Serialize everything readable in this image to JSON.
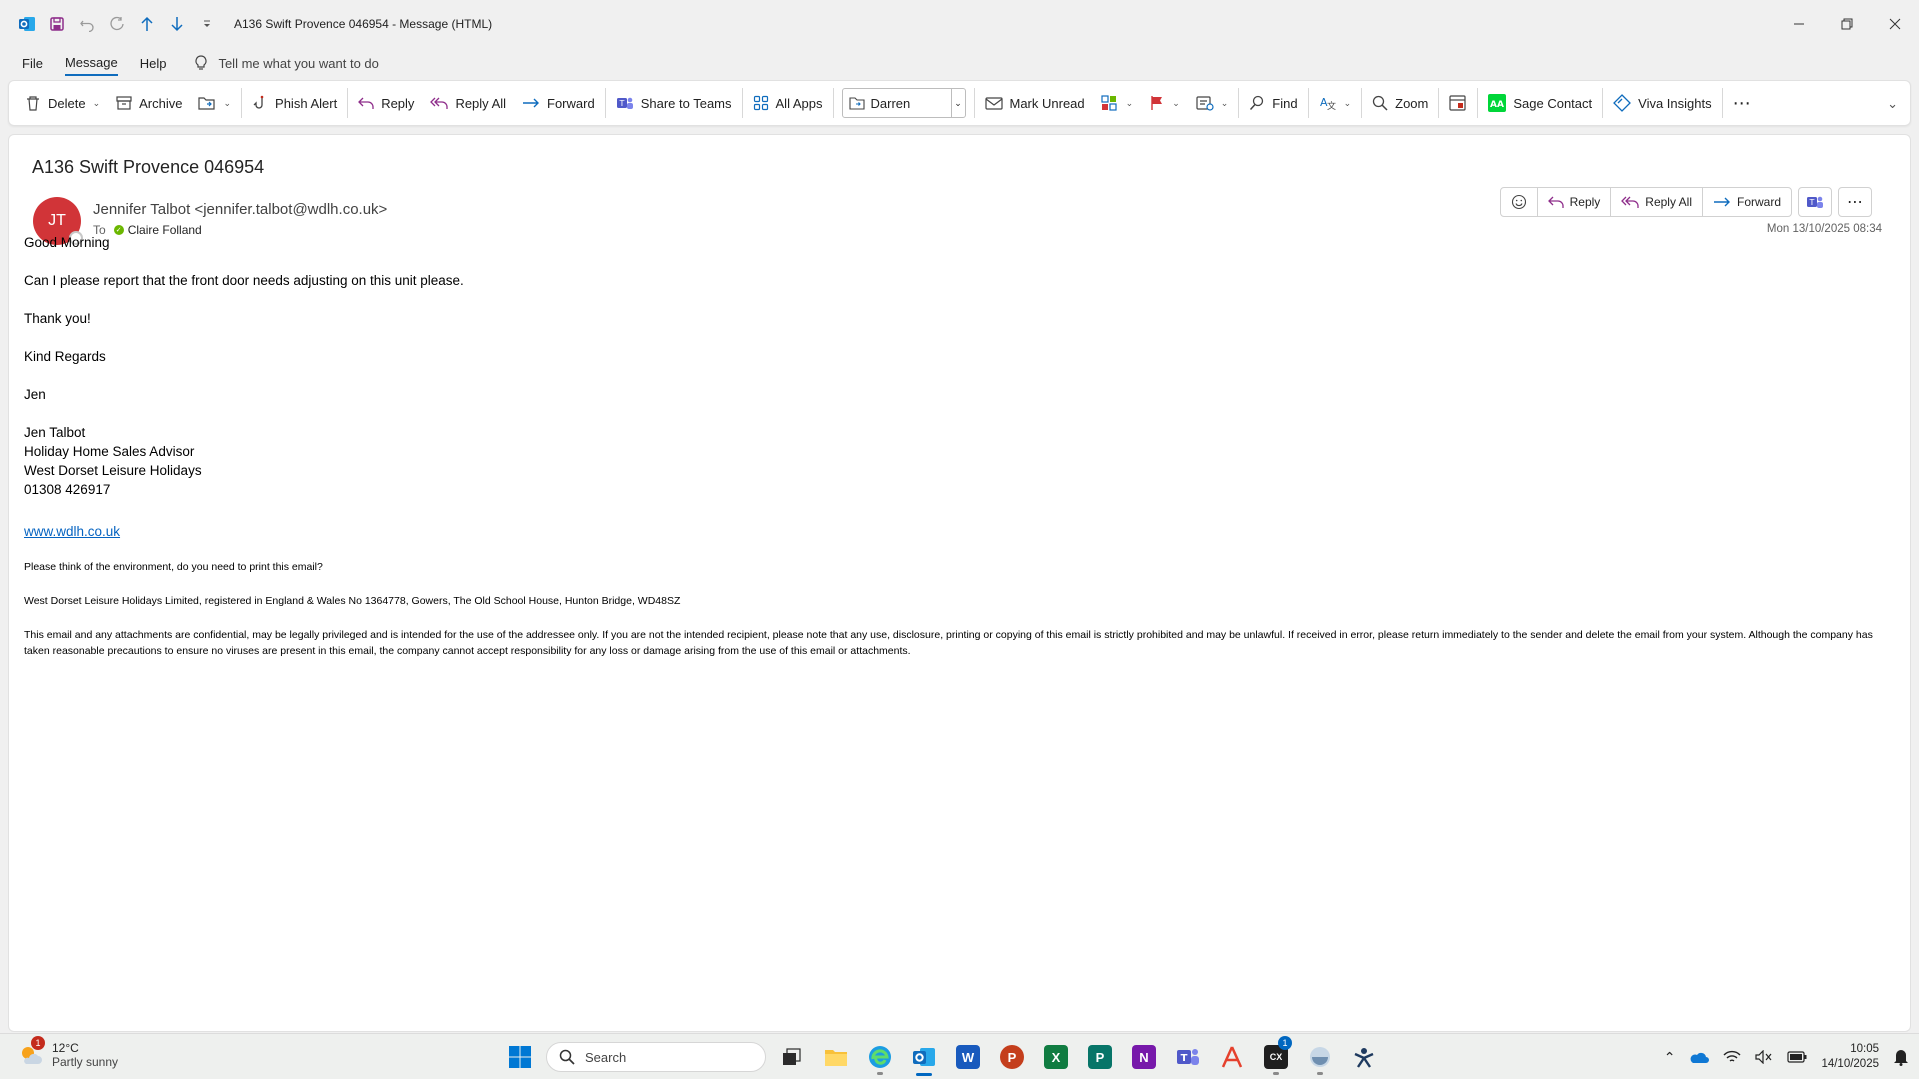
{
  "window": {
    "title": "A136 Swift Provence 046954  -  Message (HTML)"
  },
  "menu": {
    "tabs": [
      {
        "label": "File"
      },
      {
        "label": "Message"
      },
      {
        "label": "Help"
      }
    ],
    "tell_me": "Tell me what you want to do"
  },
  "ribbon": {
    "delete": "Delete",
    "archive": "Archive",
    "phish_alert": "Phish Alert",
    "reply": "Reply",
    "reply_all": "Reply All",
    "forward": "Forward",
    "share_teams": "Share to Teams",
    "all_apps": "All Apps",
    "quick_step_value": "Darren",
    "mark_unread": "Mark Unread",
    "find": "Find",
    "zoom": "Zoom",
    "sage_contact": "Sage Contact",
    "viva_insights": "Viva Insights"
  },
  "message": {
    "subject": "A136 Swift Provence 046954",
    "avatar_initials": "JT",
    "sender": "Jennifer Talbot <jennifer.talbot@wdlh.co.uk>",
    "to_label": "To",
    "recipient": "Claire Folland",
    "datetime": "Mon 13/10/2025 08:34",
    "actions": {
      "reply": "Reply",
      "reply_all": "Reply All",
      "forward": "Forward"
    },
    "body": {
      "greeting": "Good Morning",
      "line1": "Can I please report that the front door needs adjusting on this unit please.",
      "thanks": "Thank you!",
      "regards": "Kind Regards",
      "sign": "Jen",
      "sig_name": "Jen Talbot",
      "sig_title": "Holiday Home Sales Advisor",
      "sig_company": "West Dorset Leisure Holidays",
      "sig_phone": "01308 426917",
      "website": "www.wdlh.co.uk",
      "env_note": "Please think of the environment, do you need to print this email?",
      "registered": "West Dorset Leisure Holidays Limited, registered in England & Wales No 1364778, Gowers, The Old School House, Hunton Bridge, WD48SZ",
      "disclaimer": "This email and any attachments are confidential, may be legally privileged and is intended for the use of the addressee only. If you are not the intended recipient, please note that any use, disclosure, printing or copying of this email is strictly prohibited and may be unlawful. If received in error, please return immediately to the sender and delete the email from your system. Although the company has taken reasonable precautions to ensure no viruses are present in this email, the company cannot accept responsibility for any loss or damage arising from the use of this email or attachments."
    }
  },
  "taskbar": {
    "weather_temp": "12°C",
    "weather_desc": "Partly sunny",
    "weather_badge": "1",
    "search_placeholder": "Search",
    "notification_badge": "1",
    "time": "10:05",
    "date": "14/10/2025"
  },
  "colors": {
    "accent": "#0f6cbd",
    "avatar": "#d13438",
    "link": "#0563c1"
  }
}
